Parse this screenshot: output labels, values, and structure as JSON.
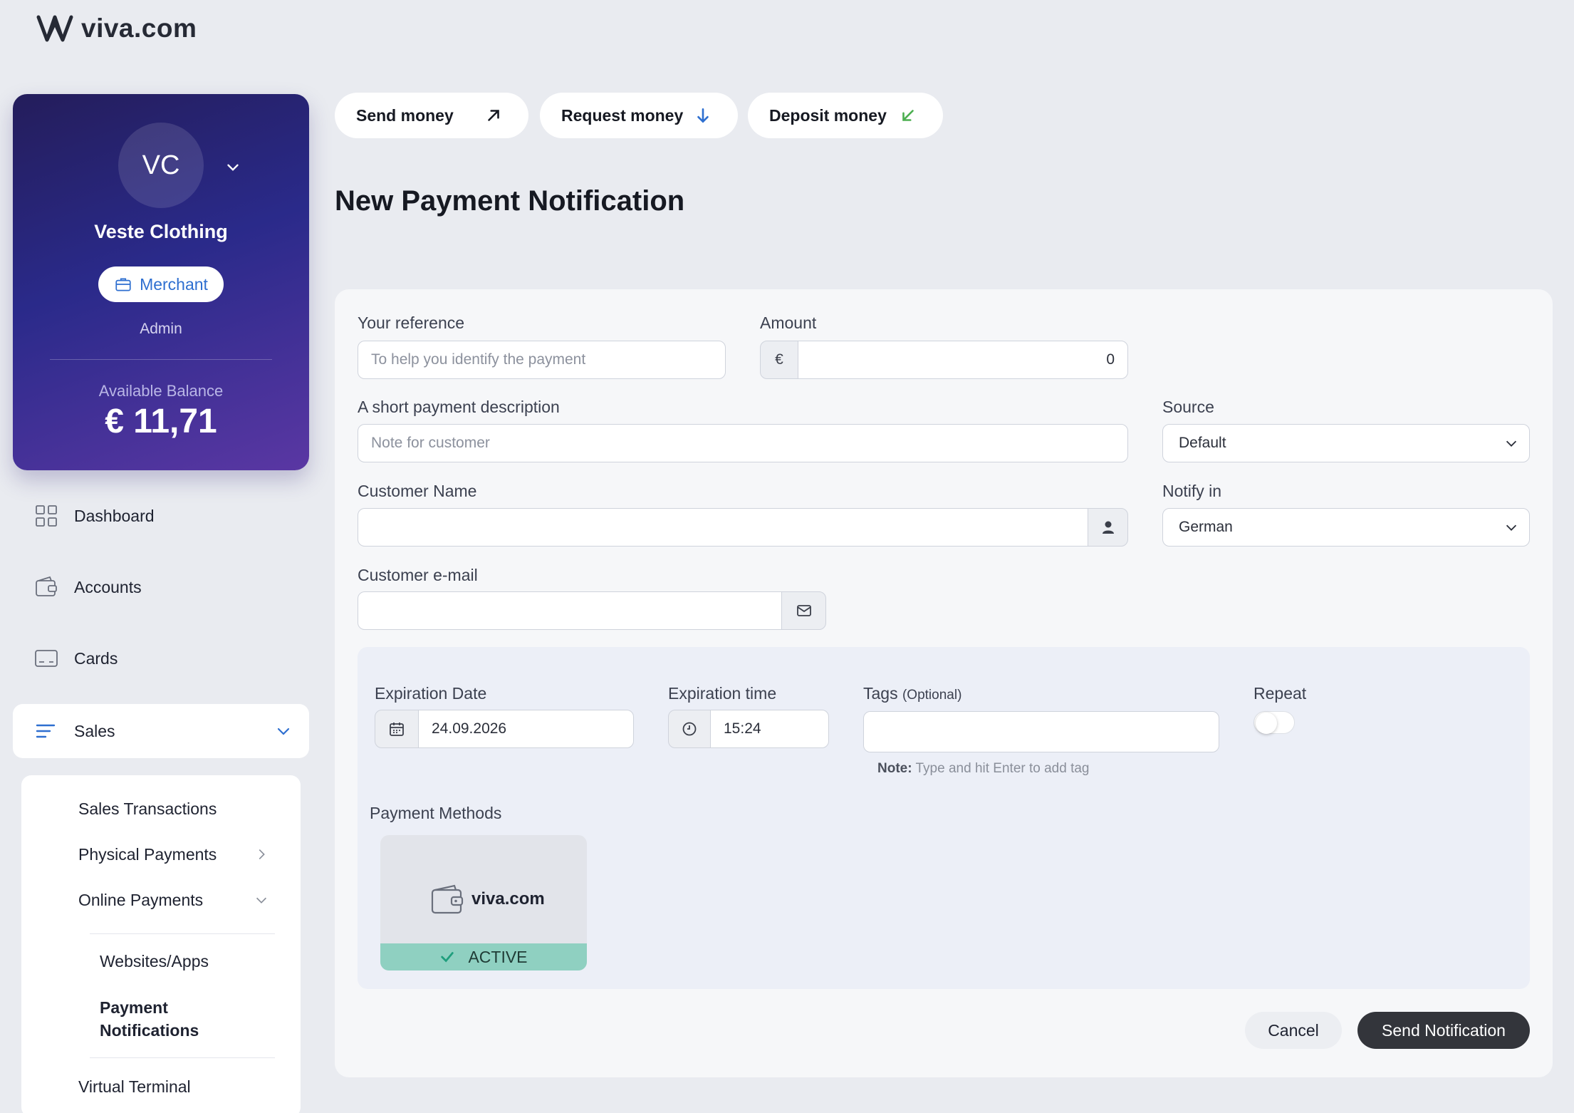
{
  "brand": {
    "name": "viva.com"
  },
  "profile": {
    "initials": "VC",
    "company": "Veste Clothing",
    "role_badge": "Merchant",
    "role": "Admin",
    "balance_label": "Available Balance",
    "balance_value": "€ 11,71"
  },
  "nav": {
    "items": [
      {
        "label": "Dashboard",
        "icon": "grid-icon"
      },
      {
        "label": "Accounts",
        "icon": "wallet-icon"
      },
      {
        "label": "Cards",
        "icon": "card-icon"
      },
      {
        "label": "Sales",
        "icon": "lines-icon"
      }
    ],
    "sales_submenu": [
      "Sales Transactions",
      "Physical Payments",
      "Online Payments",
      "Websites/Apps",
      "Payment Notifications",
      "Virtual Terminal"
    ]
  },
  "actions": {
    "send": "Send money",
    "request": "Request money",
    "deposit": "Deposit money"
  },
  "page": {
    "title": "New Payment Notification"
  },
  "form": {
    "reference_label": "Your reference",
    "reference_placeholder": "To help you identify the payment",
    "amount_label": "Amount",
    "currency_symbol": "€",
    "amount_value": "0",
    "description_label": "A short payment description",
    "description_placeholder": "Note for customer",
    "source_label": "Source",
    "source_value": "Default",
    "customer_name_label": "Customer Name",
    "notify_label": "Notify in",
    "notify_value": "German",
    "email_label": "Customer e-mail",
    "expiration_date_label": "Expiration Date",
    "expiration_date_value": "24.09.2026",
    "expiration_time_label": "Expiration time",
    "expiration_time_value": "15:24",
    "tags_label": "Tags",
    "tags_optional": "(Optional)",
    "tags_note_bold": "Note:",
    "tags_note_text": "Type and hit Enter to add tag",
    "repeat_label": "Repeat",
    "repeat_on": false,
    "payment_methods_label": "Payment Methods",
    "payment_method_name": "viva.com",
    "payment_method_status": "ACTIVE",
    "cancel_label": "Cancel",
    "send_label": "Send Notification"
  },
  "colors": {
    "accent_blue": "#2e6fd0",
    "active_green": "#8fd0c1",
    "primary_button": "#33353b"
  }
}
